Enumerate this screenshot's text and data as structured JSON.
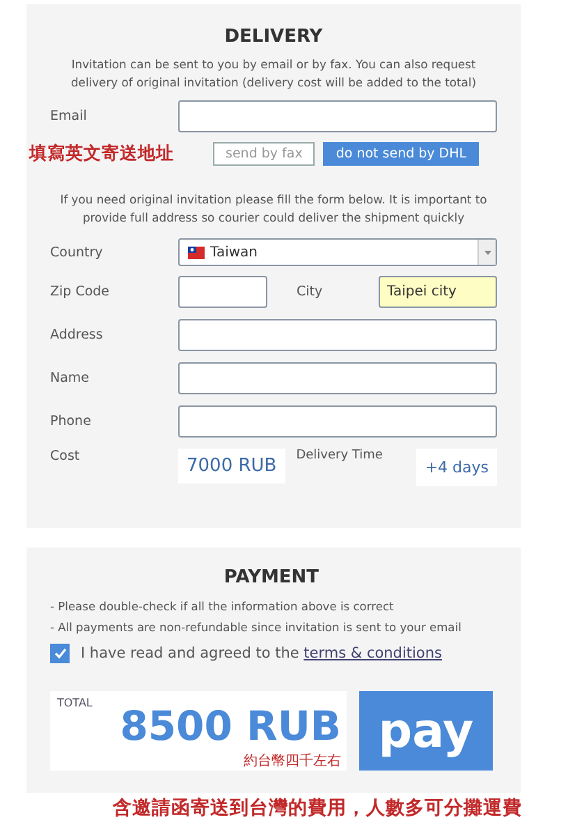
{
  "delivery": {
    "title": "DELIVERY",
    "intro": "Invitation can be sent to you by email or by fax. You can also request delivery of original invitation (delivery cost will be added to the total)",
    "email": {
      "label": "Email"
    },
    "note": "填寫英文寄送地址",
    "options": [
      {
        "label": "send by fax",
        "selected": false
      },
      {
        "label": "do not send by DHL",
        "selected": true
      }
    ],
    "address_intro": "If you need original invitation please fill the form below. It is important to provide full address so courier could deliver the shipment quickly",
    "country": {
      "label": "Country",
      "value": "Taiwan"
    },
    "zip": {
      "label": "Zip Code"
    },
    "city": {
      "label": "City",
      "value": "Taipei city",
      "highlighted": true
    },
    "fields": [
      {
        "label": "Address"
      },
      {
        "label": "Name"
      },
      {
        "label": "Phone"
      }
    ],
    "cost": {
      "label": "Cost",
      "value": "7000 RUB"
    },
    "delivery_time": {
      "label": "Delivery Time",
      "value": "+4 days"
    }
  },
  "payment": {
    "title": "PAYMENT",
    "notes": [
      "- Please double-check if all the information above is correct",
      "- All payments are non-refundable since invitation is sent to your email"
    ],
    "agree": {
      "checked": true,
      "text": "I have read and agreed to the ",
      "link": "terms & conditions"
    },
    "total_label": "TOTAL",
    "total": "8500 RUB",
    "total_note": "約台幣四千左右",
    "pay": "pay"
  },
  "footnote": "含邀請函寄送到台灣的費用，人數多可分攤運費"
}
